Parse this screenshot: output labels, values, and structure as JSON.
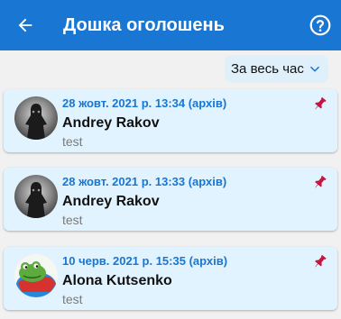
{
  "header": {
    "title": "Дошка оголошень",
    "back_icon": "arrow-back-icon",
    "help_icon": "help-circle-icon",
    "color": "#1976d2"
  },
  "filter": {
    "selected": "За весь час",
    "icon": "chevron-down-icon"
  },
  "posts": [
    {
      "meta": "28 жовт. 2021 р. 13:34 (архів)",
      "author": "Andrey Rakov",
      "text": "test",
      "pinned": true,
      "avatar": "dark-figure-avatar"
    },
    {
      "meta": "28 жовт. 2021 р. 13:33 (архів)",
      "author": "Andrey Rakov",
      "text": "test",
      "pinned": true,
      "avatar": "dark-figure-avatar"
    },
    {
      "meta": "10 черв. 2021 р. 15:35 (архів)",
      "author": "Alona Kutsenko",
      "text": "test",
      "pinned": true,
      "avatar": "frog-avatar"
    }
  ],
  "colors": {
    "accent": "#1976d2",
    "card": "#e1f3fe",
    "pin": "#c2183f"
  }
}
